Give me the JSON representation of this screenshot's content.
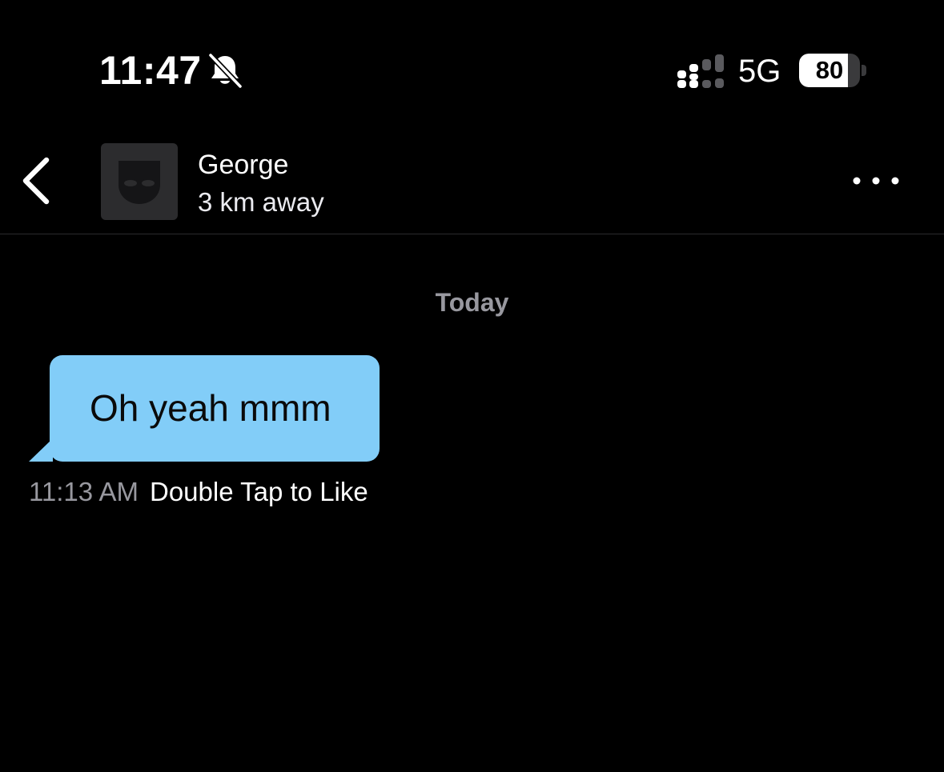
{
  "status_bar": {
    "time": "11:47",
    "network": "5G",
    "battery_level": "80",
    "battery_fraction": 0.8,
    "icons": [
      "bell-slash-icon",
      "signal-icon"
    ]
  },
  "header": {
    "back_icon": "chevron-left-icon",
    "contact_name": "George",
    "contact_distance": "3 km away",
    "avatar_icon": "mask-avatar-icon",
    "more_icon": "ellipsis-icon"
  },
  "chat": {
    "date_label": "Today",
    "messages": [
      {
        "text": "Oh yeah mmm",
        "time": "11:13 AM",
        "action_hint": "Double Tap to Like",
        "bubble_color": "#82cdf8"
      }
    ]
  },
  "colors": {
    "background": "#000000",
    "bubble": "#82cdf8",
    "secondary_text": "#98989f"
  }
}
